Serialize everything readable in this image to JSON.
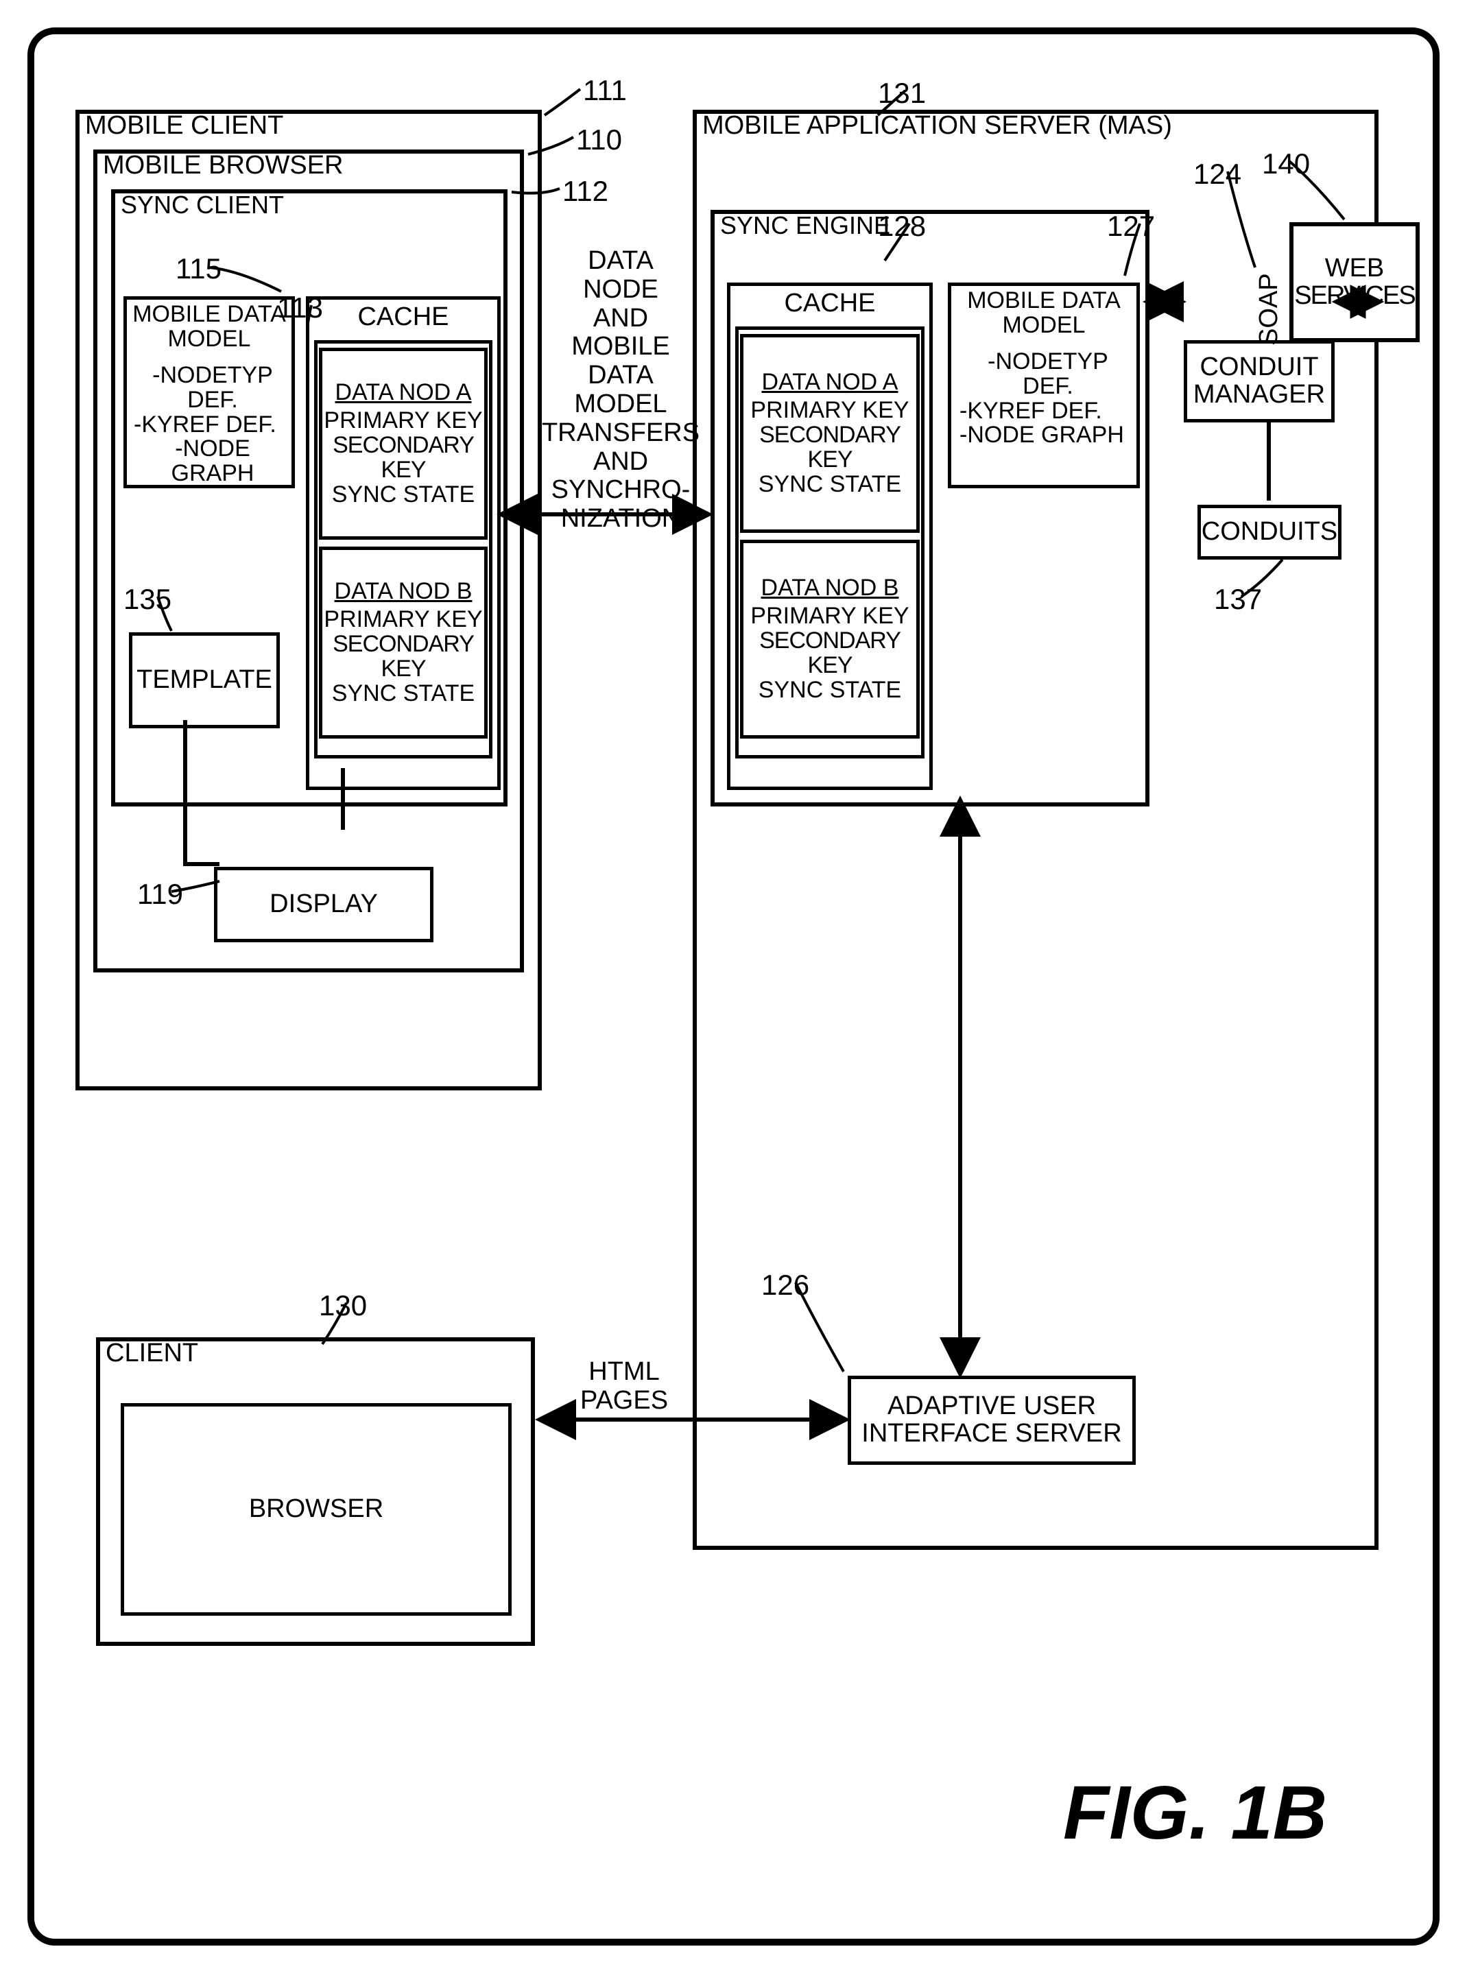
{
  "figure_title": "FIG. 1B",
  "refs": {
    "r111": "111",
    "r110": "110",
    "r112": "112",
    "r115": "115",
    "r113": "113",
    "r135": "135",
    "r119": "119",
    "r130": "130",
    "r131": "131",
    "r128": "128",
    "r127": "127",
    "r124": "124",
    "r137": "137",
    "r140": "140",
    "r126": "126"
  },
  "mobile_client": {
    "title": "MOBILE CLIENT",
    "browser_title": "MOBILE BROWSER",
    "sync_client_title": "SYNC CLIENT",
    "mdm": {
      "title1": "MOBILE DATA",
      "title2": "MODEL",
      "l1": "-NODETYP DEF.",
      "l2": "-KYREF DEF.",
      "l3": "-NODE GRAPH"
    },
    "template": "TEMPLATE",
    "cache_title": "CACHE",
    "nodeA": {
      "t": "DATA NOD A",
      "l1": "PRIMARY KEY",
      "l2": "SECONDARY KEY",
      "l3": "SYNC STATE"
    },
    "nodeB": {
      "t": "DATA NOD B",
      "l1": "PRIMARY KEY",
      "l2": "SECONDARY KEY",
      "l3": "SYNC STATE"
    },
    "display": "DISPLAY"
  },
  "mas": {
    "title1": "MOBILE APPLICATION SERVER (MAS)",
    "sync_engine_title": "SYNC ENGINE",
    "cache_title": "CACHE",
    "nodeA": {
      "t": "DATA NOD A",
      "l1": "PRIMARY KEY",
      "l2": "SECONDARY KEY",
      "l3": "SYNC STATE"
    },
    "nodeB": {
      "t": "DATA NOD B",
      "l1": "PRIMARY KEY",
      "l2": "SECONDARY KEY",
      "l3": "SYNC STATE"
    },
    "mdm": {
      "title1": "MOBILE DATA",
      "title2": "MODEL",
      "l1": "-NODETYP DEF.",
      "l2": "-KYREF DEF.",
      "l3": "-NODE GRAPH"
    },
    "conduit_mgr1": "CONDUIT",
    "conduit_mgr2": "MANAGER",
    "conduits": "CONDUITS",
    "aui1": "ADAPTIVE USER",
    "aui2": "INTERFACE SERVER"
  },
  "web_services": {
    "l1": "WEB",
    "l2": "SERVICES"
  },
  "client": {
    "title": "CLIENT",
    "browser": "BROWSER"
  },
  "conn": {
    "sync": {
      "l1": "DATA NODE",
      "l2": "AND MOBILE",
      "l3": "DATA MODEL",
      "l4": "TRANSFERS",
      "l5": "AND",
      "l6": "SYNCHRO-",
      "l7": "NIZATION"
    },
    "html": {
      "l1": "HTML",
      "l2": "PAGES"
    },
    "soap": "SOAP"
  }
}
